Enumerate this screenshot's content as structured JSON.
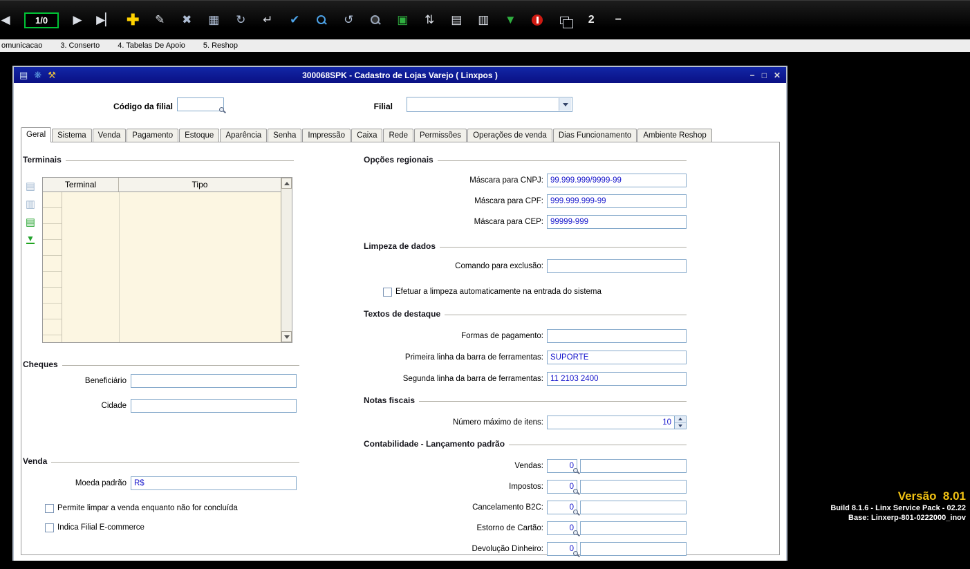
{
  "toolbar": {
    "counter": "1/0",
    "open_windows": "2",
    "icons": {
      "prev": "◀",
      "next": "▶",
      "last": "▶▏",
      "add": "✚",
      "edit": "✎",
      "delete": "✖",
      "save": "▦",
      "save_refresh": "↻",
      "confirm": "↵",
      "clean": "✔",
      "refresh": "↺",
      "print": "▣",
      "sort": "⇅",
      "doc_new": "▤",
      "doc": "▥",
      "filter": "▼",
      "collapse": "−"
    }
  },
  "menubar": {
    "items": [
      "omunicacao",
      "3. Conserto",
      "4. Tabelas De Apoio",
      "5. Reshop"
    ]
  },
  "window": {
    "title": "300068SPK - Cadastro de Lojas Varejo ( Linxpos )",
    "titlebar_icons": {
      "doc": "▤",
      "logo": "❋",
      "tools": "⚒"
    },
    "controls": {
      "minimize": "−",
      "maximize": "□",
      "close": "✕"
    },
    "header": {
      "codigo_label": "Código da filial",
      "codigo_value": "",
      "filial_label": "Filial",
      "filial_value": ""
    },
    "tabs": [
      "Geral",
      "Sistema",
      "Venda",
      "Pagamento",
      "Estoque",
      "Aparência",
      "Senha",
      "Impressão",
      "Caixa",
      "Rede",
      "Permissões",
      "Operações de venda",
      "Dias Funcionamento",
      "Ambiente Reshop"
    ],
    "terminais": {
      "heading": "Terminais",
      "columns": [
        "Terminal",
        "Tipo"
      ],
      "rows": []
    },
    "cheques": {
      "heading": "Cheques",
      "beneficiario_label": "Beneficiário",
      "beneficiario_value": "",
      "cidade_label": "Cidade",
      "cidade_value": ""
    },
    "venda": {
      "heading": "Venda",
      "moeda_label": "Moeda padrão",
      "moeda_value": "R$",
      "cb_limpar": "Permite limpar a venda enquanto não for concluída",
      "cb_ecommerce": "Indica Filial E-commerce"
    },
    "opcoes_regionais": {
      "heading": "Opções regionais",
      "cnpj_label": "Máscara para CNPJ:",
      "cnpj_value": "99.999.999/9999-99",
      "cpf_label": "Máscara para CPF:",
      "cpf_value": "999.999.999-99",
      "cep_label": "Máscara para CEP:",
      "cep_value": "99999-999"
    },
    "limpeza": {
      "heading": "Limpeza de dados",
      "comando_label": "Comando para exclusão:",
      "comando_value": "",
      "cb_auto": "Efetuar a limpeza automaticamente na entrada do sistema"
    },
    "textos": {
      "heading": "Textos de destaque",
      "formas_label": "Formas de pagamento:",
      "formas_value": "",
      "primeira_label": "Primeira linha da barra de ferramentas:",
      "primeira_value": "SUPORTE",
      "segunda_label": "Segunda linha da barra de ferramentas:",
      "segunda_value": "11 2103 2400"
    },
    "notas": {
      "heading": "Notas fiscais",
      "max_label": "Número máximo de itens:",
      "max_value": "10"
    },
    "contabilidade": {
      "heading": "Contabilidade - Lançamento padrão",
      "rows": [
        {
          "label": "Vendas:",
          "code": "0",
          "desc": ""
        },
        {
          "label": "Impostos:",
          "code": "0",
          "desc": ""
        },
        {
          "label": "Cancelamento B2C:",
          "code": "0",
          "desc": ""
        },
        {
          "label": "Estorno de Cartão:",
          "code": "0",
          "desc": ""
        },
        {
          "label": "Devolução Dinheiro:",
          "code": "0",
          "desc": ""
        }
      ]
    }
  },
  "version": {
    "line1": "Versão  8.01",
    "line2": "Build 8.1.6 - Linx Service Pack - 02.22",
    "line3": "Base: Linxerp-801-0222000_inov"
  }
}
